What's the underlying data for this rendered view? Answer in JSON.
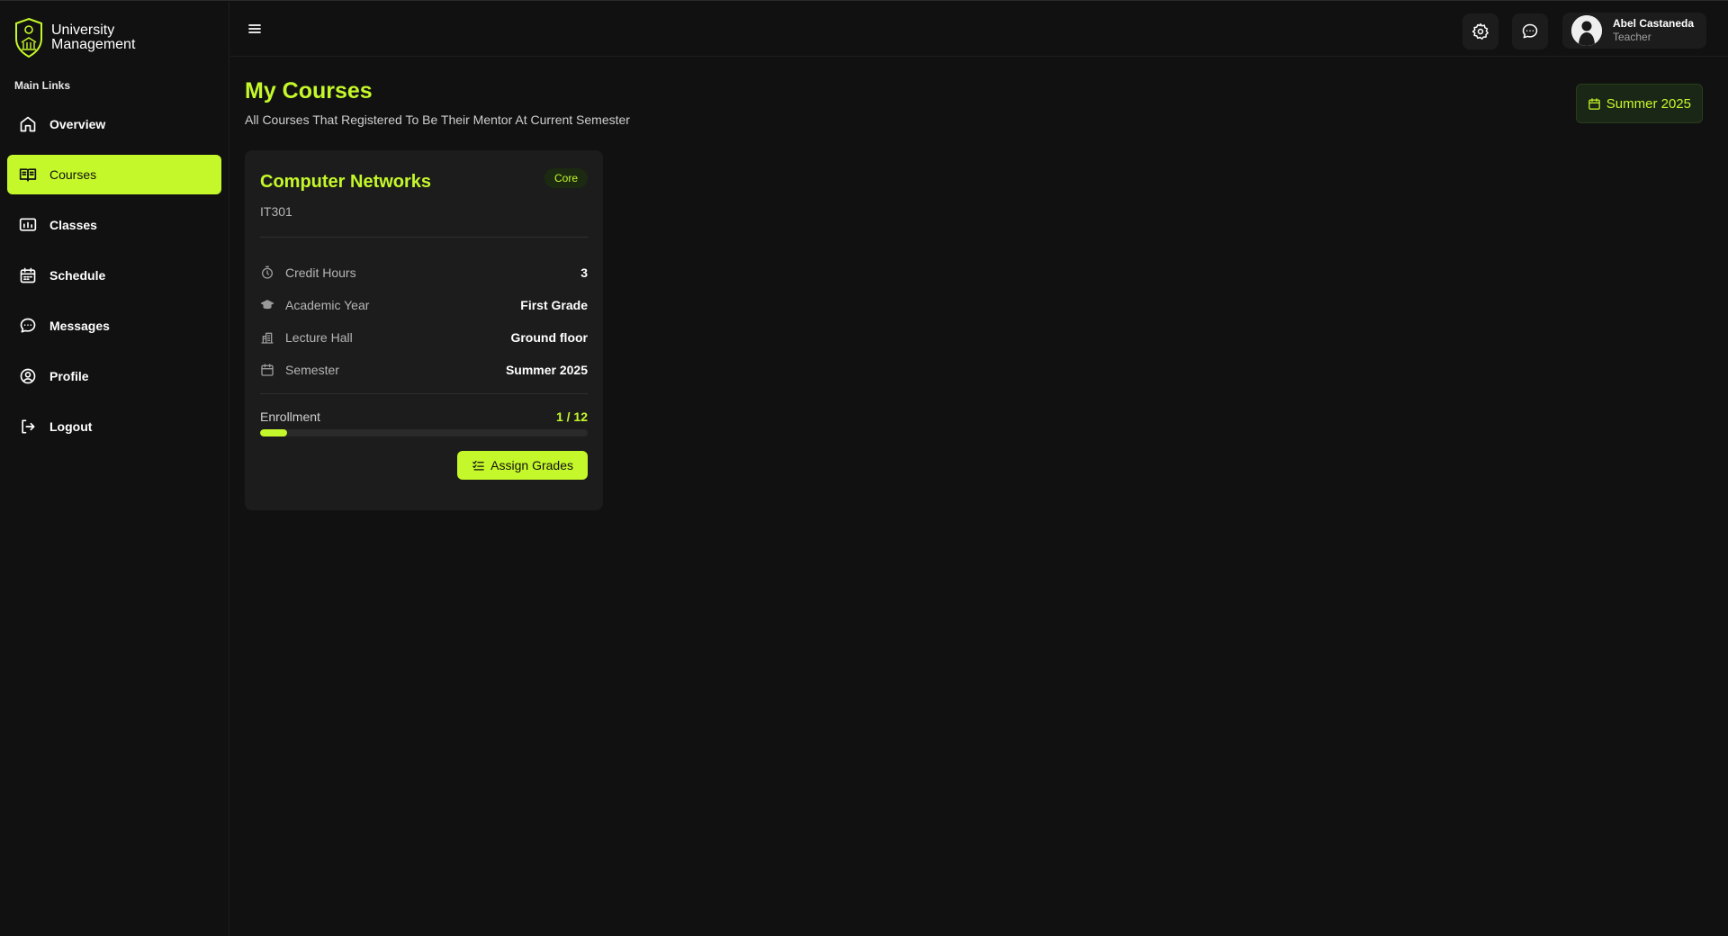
{
  "brand": {
    "line1": "University",
    "line2": "Management"
  },
  "sidebar": {
    "section_label": "Main Links",
    "items": [
      {
        "label": "Overview",
        "icon": "home-icon",
        "active": false
      },
      {
        "label": "Courses",
        "icon": "book-icon",
        "active": true
      },
      {
        "label": "Classes",
        "icon": "presentation-icon",
        "active": false
      },
      {
        "label": "Schedule",
        "icon": "calendar-icon",
        "active": false
      },
      {
        "label": "Messages",
        "icon": "message-icon",
        "active": false
      },
      {
        "label": "Profile",
        "icon": "user-circle-icon",
        "active": false
      },
      {
        "label": "Logout",
        "icon": "logout-icon",
        "active": false
      }
    ]
  },
  "header": {
    "user": {
      "name": "Abel Castaneda",
      "role": "Teacher"
    }
  },
  "main": {
    "title": "My Courses",
    "subtitle": "All Courses That Registered To Be Their Mentor At Current Semester",
    "semester_badge": "Summer 2025"
  },
  "course_card": {
    "title": "Computer Networks",
    "badge": "Core",
    "code": "IT301",
    "details": [
      {
        "label": "Credit Hours",
        "value": "3",
        "icon": "timer-icon"
      },
      {
        "label": "Academic Year",
        "value": "First Grade",
        "icon": "graduation-cap-icon"
      },
      {
        "label": "Lecture Hall",
        "value": "Ground floor",
        "icon": "building-icon"
      },
      {
        "label": "Semester",
        "value": "Summer 2025",
        "icon": "calendar-icon"
      }
    ],
    "enrollment": {
      "label": "Enrollment",
      "value": "1 / 12",
      "fraction": 0.0833
    },
    "action_label": "Assign Grades"
  },
  "colors": {
    "accent": "#c5f82a",
    "background": "#111111",
    "card": "#1c1c1c"
  }
}
